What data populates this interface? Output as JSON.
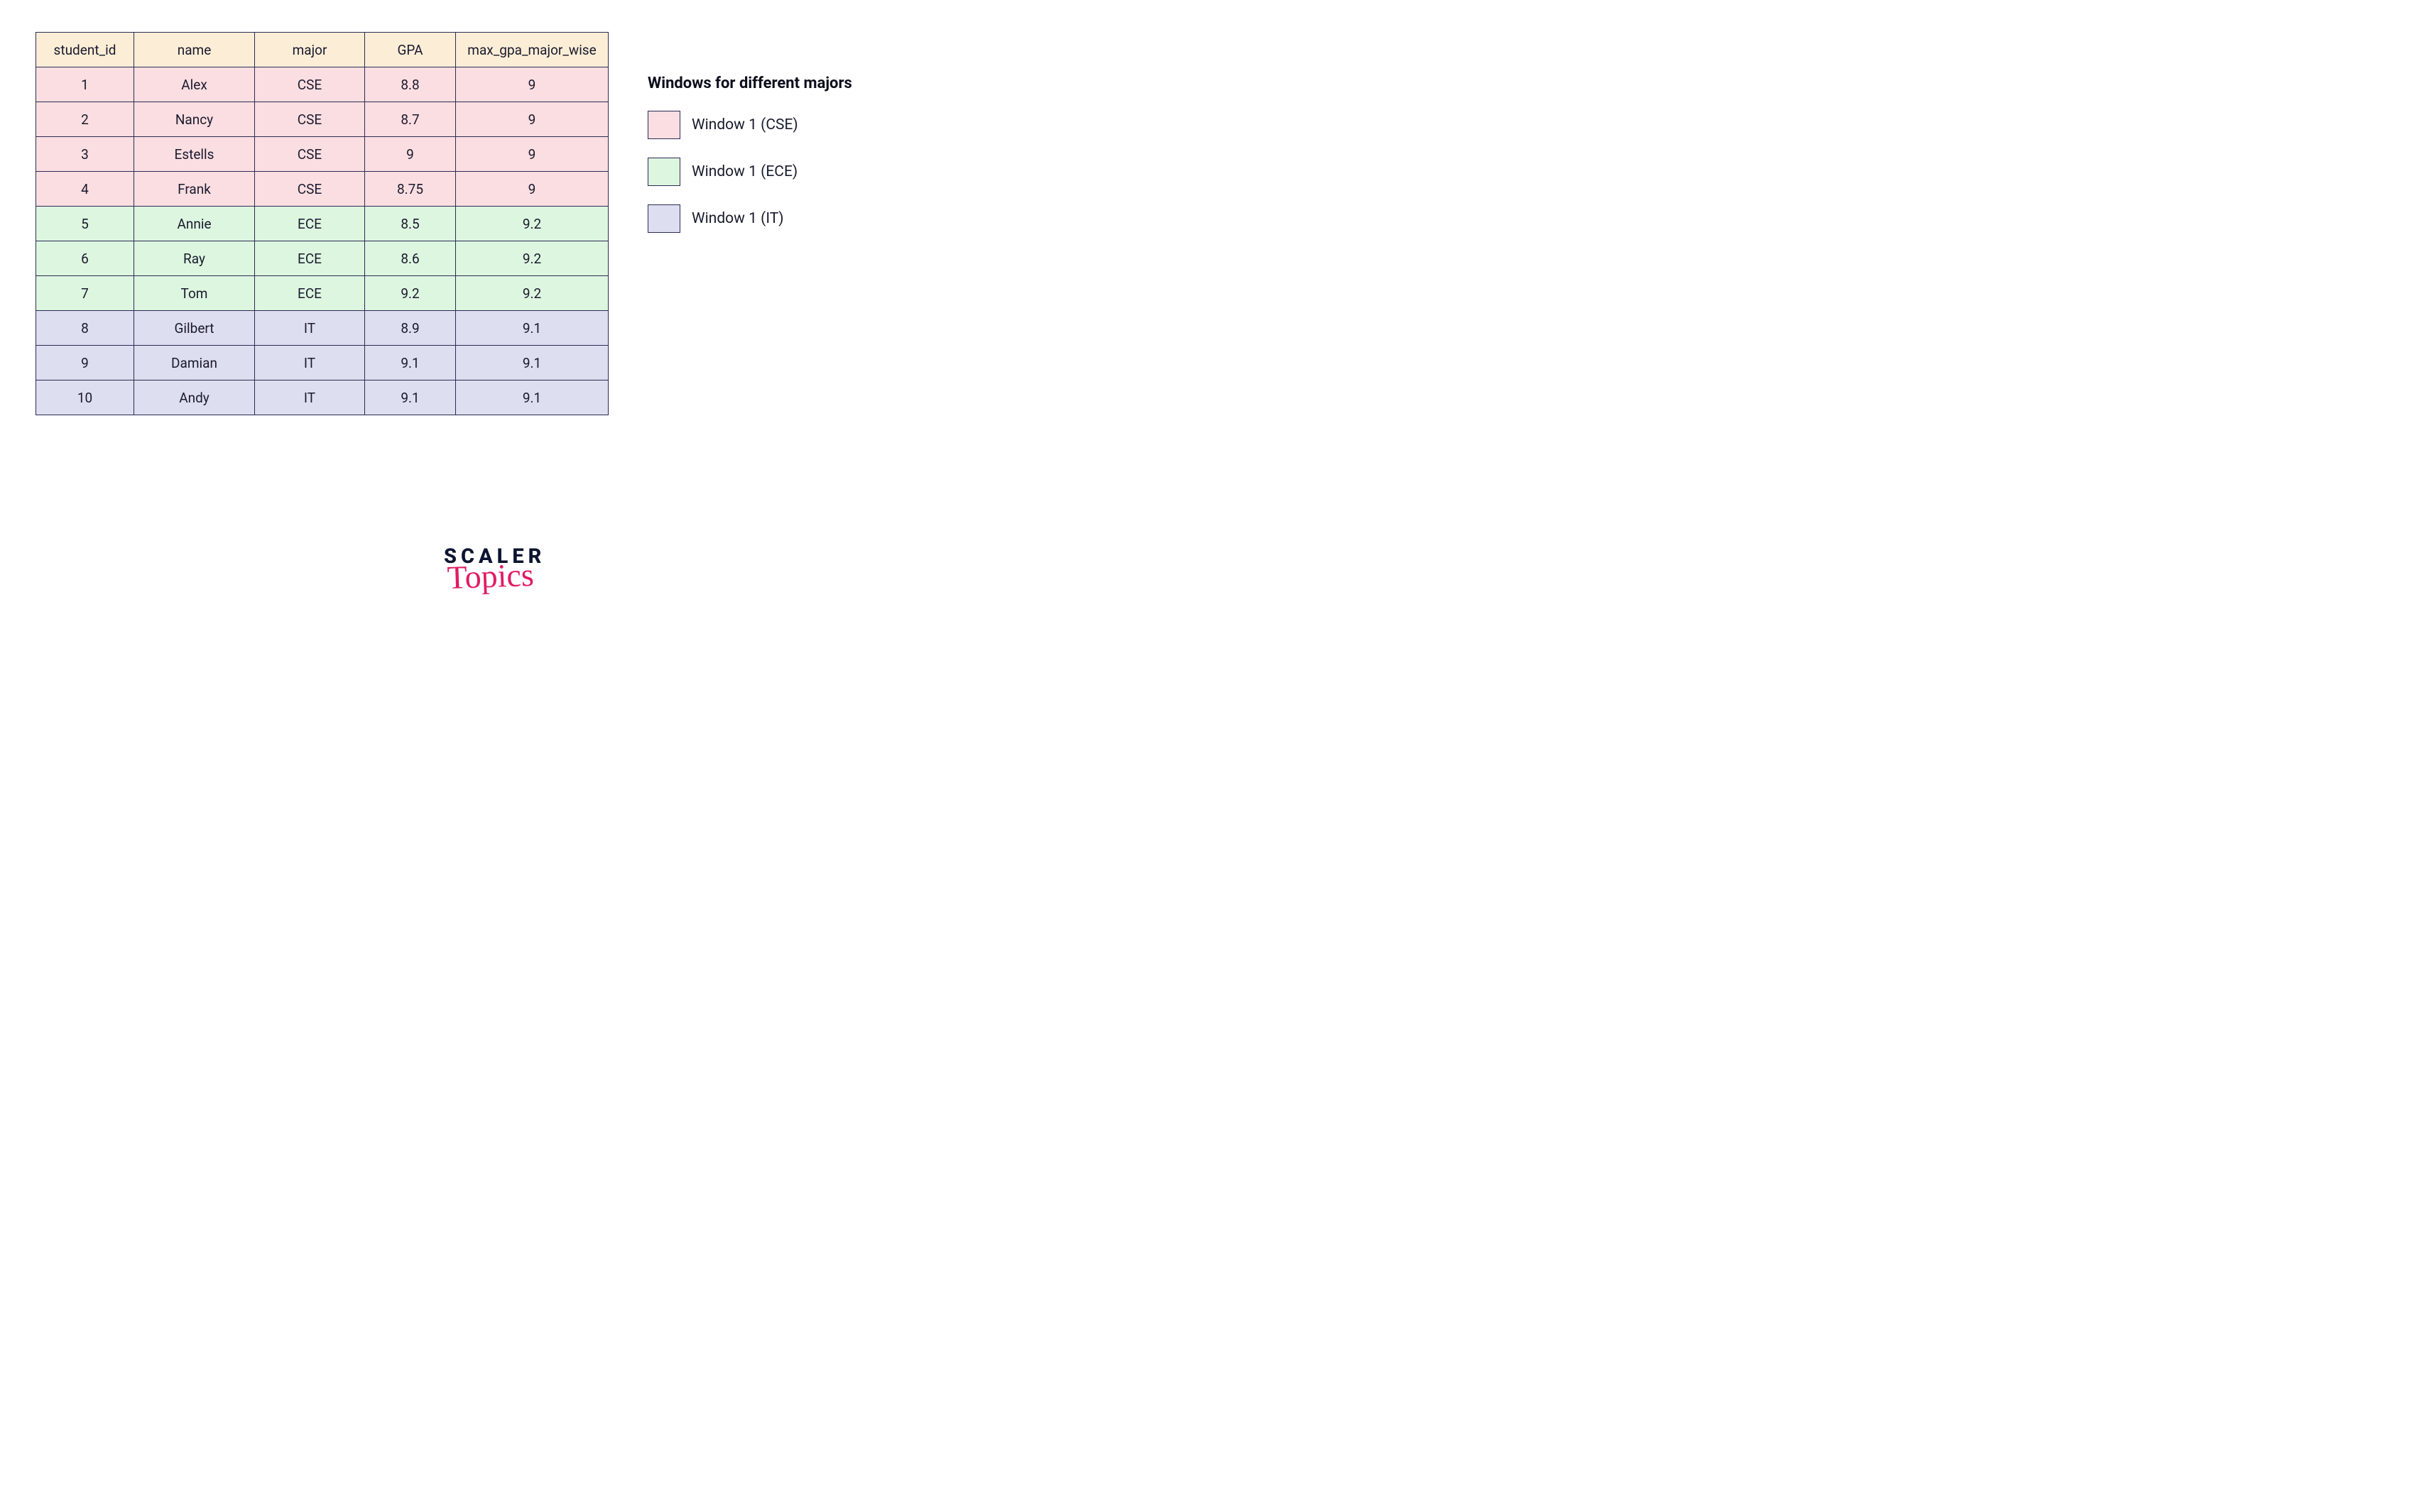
{
  "table": {
    "headers": {
      "student_id": "student_id",
      "name": "name",
      "major": "major",
      "gpa": "GPA",
      "max": "max_gpa_major_wise"
    },
    "rows": [
      {
        "student_id": "1",
        "name": "Alex",
        "major": "CSE",
        "gpa": "8.8",
        "max": "9",
        "window": "cse"
      },
      {
        "student_id": "2",
        "name": "Nancy",
        "major": "CSE",
        "gpa": "8.7",
        "max": "9",
        "window": "cse"
      },
      {
        "student_id": "3",
        "name": "Estells",
        "major": "CSE",
        "gpa": "9",
        "max": "9",
        "window": "cse"
      },
      {
        "student_id": "4",
        "name": "Frank",
        "major": "CSE",
        "gpa": "8.75",
        "max": "9",
        "window": "cse"
      },
      {
        "student_id": "5",
        "name": "Annie",
        "major": "ECE",
        "gpa": "8.5",
        "max": "9.2",
        "window": "ece"
      },
      {
        "student_id": "6",
        "name": "Ray",
        "major": "ECE",
        "gpa": "8.6",
        "max": "9.2",
        "window": "ece"
      },
      {
        "student_id": "7",
        "name": "Tom",
        "major": "ECE",
        "gpa": "9.2",
        "max": "9.2",
        "window": "ece"
      },
      {
        "student_id": "8",
        "name": "Gilbert",
        "major": "IT",
        "gpa": "8.9",
        "max": "9.1",
        "window": "it"
      },
      {
        "student_id": "9",
        "name": "Damian",
        "major": "IT",
        "gpa": "9.1",
        "max": "9.1",
        "window": "it"
      },
      {
        "student_id": "10",
        "name": "Andy",
        "major": "IT",
        "gpa": "9.1",
        "max": "9.1",
        "window": "it"
      }
    ]
  },
  "legend": {
    "title": "Windows for different majors",
    "items": [
      {
        "label": "Window 1 (CSE)",
        "class": "cse"
      },
      {
        "label": "Window 1 (ECE)",
        "class": "ece"
      },
      {
        "label": "Window 1 (IT)",
        "class": "it"
      }
    ]
  },
  "logo": {
    "line1": "SCALER",
    "line2": "Topics"
  },
  "colors": {
    "header_bg": "#fceed6",
    "cse_bg": "#fbdee1",
    "ece_bg": "#ddf6e0",
    "it_bg": "#dddeef",
    "border": "#2b2b54"
  }
}
